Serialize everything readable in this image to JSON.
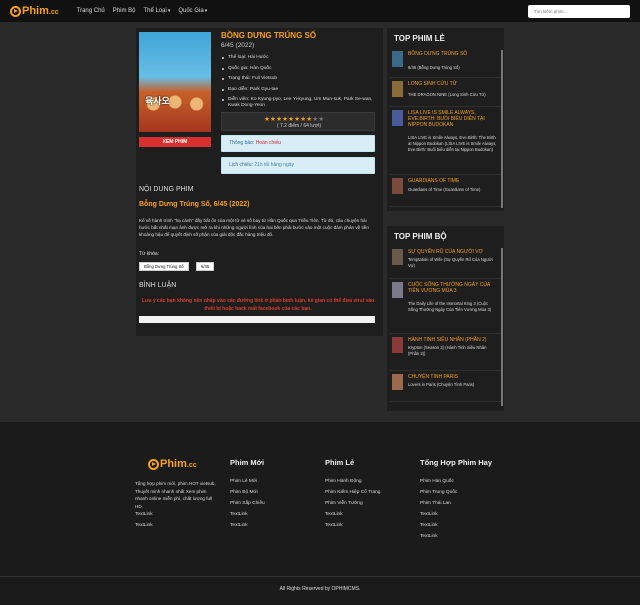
{
  "brand": {
    "name": "Phim",
    "suffix": ".cc"
  },
  "nav": {
    "items": [
      "Trang Chủ",
      "Phim Bộ",
      "Thể Loại",
      "Quốc Gia"
    ],
    "dropdown_caret": "▾",
    "search_placeholder": "Tìm kiếm phim..."
  },
  "movie": {
    "title": "BỒNG DƯNG TRÚNG SỐ",
    "subtitle": "6/45 (2022)",
    "poster_text": "육사오",
    "watch_label": "XEM PHIM",
    "info": [
      "Thể loại: Hài Hước",
      "Quốc gia: Hàn Quốc",
      "Trạng thái: Full Vietsub",
      "Đạo diễn: Park Gyu-tae",
      "Diễn viên: Ko Kyung-pyo, Lee Yi-kyung, Um Mun-suk, Park Se-wan, Kwak Dong-Yeon"
    ],
    "rating_stars": 8,
    "rating_total": 10,
    "rating_text": "( 7.2 điểm / 64 lượt)",
    "notice_label": "Thông báo:",
    "notice_value": "Hoàn chiếu",
    "schedule_label": "Lịch chiếu:",
    "schedule_value": "21h tối hàng ngày"
  },
  "content": {
    "heading": "NỘI DUNG PHIM",
    "title": "Bỗng Dưng Trúng Số, 6/45 (2022)",
    "body": "Kể về hành trình \"hạ cánh\" đầy bất ổn của một tờ vé số bay từ Hàn Quốc qua Triều Tiên. Từ đó, câu chuyện hài hước bắt nhất mạn ảnh được mở ra khi những người lính của hai bên phải bước vào một cuộc đàm phán về tiền khoảng hậu để quyết định số phận của giải độc đắc hàng triệu đô.",
    "keywords_label": "Từ khóa:",
    "tags": [
      "Bỗng Dưng Trúng Số",
      "6/45"
    ]
  },
  "comments": {
    "heading": "BÌNH LUẬN",
    "warning": "Lưu ý các bạn không nên nhấp vào các đường link ở phần bình luận, kẻ gian có thể đưa virut vào thiết bị hoặc hack mất facebook của các bạn."
  },
  "top_le": {
    "heading": "TOP PHIM LẺ",
    "items": [
      {
        "title": "BỒNG DƯNG TRÚNG SỐ",
        "sub": "6/45 (Bỗng Dưng Trúng Số)"
      },
      {
        "title": "LONG SINH CỬU TỬ",
        "sub": "THE DRAGON NINE (Long Sinh Cửu Tử)"
      },
      {
        "title": "LISA LIVE IS SMILE ALWAYS, EVE.BIRTH: BUỔI BIỂU DIỄN TẠI NIPPON BUDOKAN",
        "sub": "LISA LIVE is Smile Always, Eve.Birth: The Birth at Nippon Budokan (LISA LIVE is Smile Always, Eve.Birth: Buổi biểu diễn tại Nippon Budokan)"
      },
      {
        "title": "GUARDIANS OF TIME",
        "sub": "Guardians of Time (Guardians of Time)"
      }
    ]
  },
  "top_bo": {
    "heading": "TOP PHIM BỘ",
    "items": [
      {
        "title": "SỰ QUYẾN RŨ CỦA NGƯỜI VỢ",
        "sub": "Temptation of Wife (Sự Quyến Rũ Của Người Vợ)"
      },
      {
        "title": "CUỘC SỐNG THƯỜNG NGÀY CỦA TIÊN VƯƠNG MÙA 3",
        "sub": "The Daily Life of the Immortal King 3 (Cuộc Sống Thường Ngày Của Tiên Vương Mùa 3)"
      },
      {
        "title": "HÀNH TINH SIÊU NHÂN (PHẦN 2)",
        "sub": "Krypton (Season 2) (Hành Tinh Siêu Nhân (Phần 2))"
      },
      {
        "title": "CHUYỆN TÌNH PARIS",
        "sub": "Lovers in Paris (Chuyện Tình Paris)"
      }
    ]
  },
  "footer": {
    "desc": "Tổng hợp phim mới, phim HOT vietsub, Thuyết minh nhanh nhất Xem phim nhanh online miễn phí, chất lượng full HD.",
    "col0_links": [
      "TextLink",
      "TextLink"
    ],
    "columns": [
      {
        "heading": "Phim Mới",
        "links": [
          "Phim Lẻ Mới",
          "Phim Bộ Mới",
          "Phim Sắp Chiếu",
          "TextLink",
          "TextLink"
        ]
      },
      {
        "heading": "Phim Lẻ",
        "links": [
          "Phim Hành Động",
          "Phim Kiếm Hiệp Cổ Trang",
          "Phim Viễn Tưởng",
          "TextLink",
          "TextLink"
        ]
      },
      {
        "heading": "Tổng Hợp Phim Hay",
        "links": [
          "Phim Hàn Quốc",
          "Phim Trung Quốc",
          "Phim Thái Lan",
          "TextLink",
          "TextLink",
          "TextLink"
        ]
      }
    ],
    "copyright": "All Rights Reserved by OPHIMCMS."
  },
  "colors": {
    "accent": "#f6a01a",
    "watch_button": "#d92f2f",
    "notice_bg": "#d9edf7"
  }
}
